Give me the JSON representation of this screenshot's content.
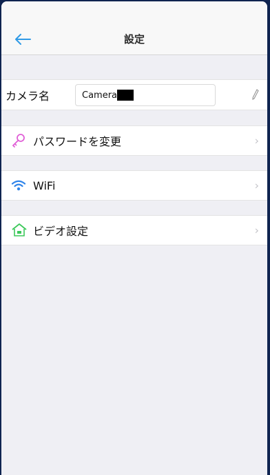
{
  "header": {
    "title": "設定"
  },
  "camera_name": {
    "label": "カメラ名",
    "value": "Camera"
  },
  "menu": {
    "change_password": "パスワードを変更",
    "wifi": "WiFi",
    "video_settings": "ビデオ設定"
  },
  "colors": {
    "accent": "#2f9ae6",
    "key_icon": "#e05fd6",
    "wifi_icon": "#2f84ea",
    "video_icon": "#3cc85a",
    "status_indicator": "#1ec94b"
  }
}
